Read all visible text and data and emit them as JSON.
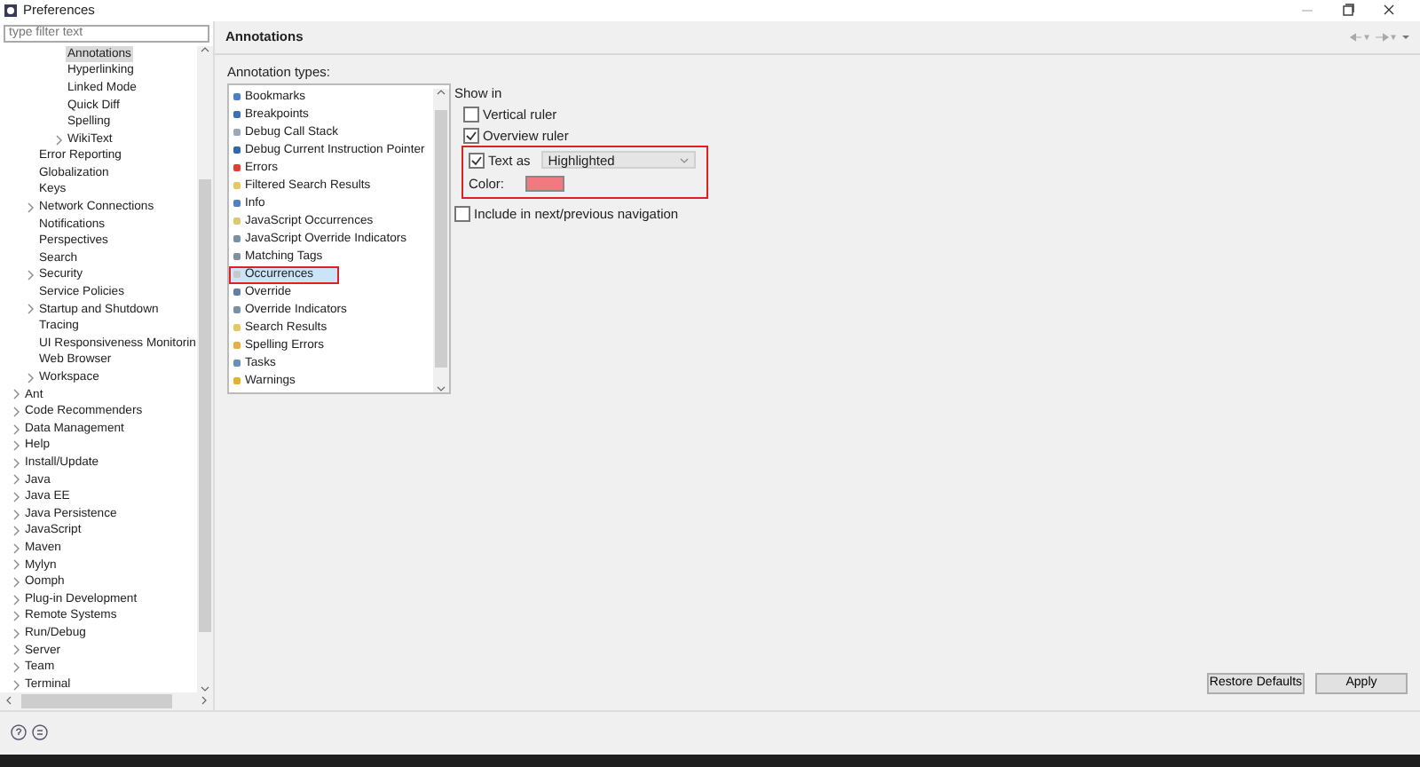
{
  "window": {
    "title": "Preferences"
  },
  "filter": {
    "placeholder": "type filter text"
  },
  "tree": [
    {
      "children": [
        {
          "children": [
            {
              "label": "Annotations",
              "selected": true,
              "expandable": false
            },
            {
              "label": "Hyperlinking",
              "selected": false,
              "expandable": false
            },
            {
              "label": "Linked Mode",
              "selected": false,
              "expandable": false
            },
            {
              "label": "Quick Diff",
              "selected": false,
              "expandable": false
            },
            {
              "label": "Spelling",
              "selected": false,
              "expandable": false
            },
            {
              "label": "WikiText",
              "selected": false,
              "expandable": true
            }
          ]
        },
        {
          "label": "Error Reporting",
          "selected": false,
          "expandable": false
        },
        {
          "label": "Globalization",
          "selected": false,
          "expandable": false
        },
        {
          "label": "Keys",
          "selected": false,
          "expandable": false
        },
        {
          "label": "Network Connections",
          "selected": false,
          "expandable": true
        },
        {
          "label": "Notifications",
          "selected": false,
          "expandable": false
        },
        {
          "label": "Perspectives",
          "selected": false,
          "expandable": false
        },
        {
          "label": "Search",
          "selected": false,
          "expandable": false
        },
        {
          "label": "Security",
          "selected": false,
          "expandable": true
        },
        {
          "label": "Service Policies",
          "selected": false,
          "expandable": false
        },
        {
          "label": "Startup and Shutdown",
          "selected": false,
          "expandable": true
        },
        {
          "label": "Tracing",
          "selected": false,
          "expandable": false
        },
        {
          "label": "UI Responsiveness Monitorin",
          "selected": false,
          "expandable": false
        },
        {
          "label": "Web Browser",
          "selected": false,
          "expandable": false
        },
        {
          "label": "Workspace",
          "selected": false,
          "expandable": true
        }
      ]
    },
    {
      "label": "Ant",
      "selected": false,
      "expandable": true
    },
    {
      "label": "Code Recommenders",
      "selected": false,
      "expandable": true
    },
    {
      "label": "Data Management",
      "selected": false,
      "expandable": true
    },
    {
      "label": "Help",
      "selected": false,
      "expandable": true
    },
    {
      "label": "Install/Update",
      "selected": false,
      "expandable": true
    },
    {
      "label": "Java",
      "selected": false,
      "expandable": true
    },
    {
      "label": "Java EE",
      "selected": false,
      "expandable": true
    },
    {
      "label": "Java Persistence",
      "selected": false,
      "expandable": true
    },
    {
      "label": "JavaScript",
      "selected": false,
      "expandable": true
    },
    {
      "label": "Maven",
      "selected": false,
      "expandable": true
    },
    {
      "label": "Mylyn",
      "selected": false,
      "expandable": true
    },
    {
      "label": "Oomph",
      "selected": false,
      "expandable": true
    },
    {
      "label": "Plug-in Development",
      "selected": false,
      "expandable": true
    },
    {
      "label": "Remote Systems",
      "selected": false,
      "expandable": true
    },
    {
      "label": "Run/Debug",
      "selected": false,
      "expandable": true
    },
    {
      "label": "Server",
      "selected": false,
      "expandable": true
    },
    {
      "label": "Team",
      "selected": false,
      "expandable": true
    },
    {
      "label": "Terminal",
      "selected": false,
      "expandable": true
    }
  ],
  "page": {
    "title": "Annotations",
    "list_label": "Annotation types:",
    "annotation_types": [
      {
        "label": "Bookmarks",
        "color": "#4a7fd0",
        "selected": false,
        "outlined": false
      },
      {
        "label": "Breakpoints",
        "color": "#3a6fc0",
        "selected": false,
        "outlined": false
      },
      {
        "label": "Debug Call Stack",
        "color": "#9aa8b8",
        "selected": false,
        "outlined": false
      },
      {
        "label": "Debug Current Instruction Pointer",
        "color": "#3068b0",
        "selected": false,
        "outlined": false
      },
      {
        "label": "Errors",
        "color": "#e04030",
        "selected": false,
        "outlined": false
      },
      {
        "label": "Filtered Search Results",
        "color": "#e8c860",
        "selected": false,
        "outlined": false
      },
      {
        "label": "Info",
        "color": "#5080c8",
        "selected": false,
        "outlined": false
      },
      {
        "label": "JavaScript Occurrences",
        "color": "#e0c870",
        "selected": false,
        "outlined": false
      },
      {
        "label": "JavaScript Override Indicators",
        "color": "#7890a8",
        "selected": false,
        "outlined": false
      },
      {
        "label": "Matching Tags",
        "color": "#8090a0",
        "selected": false,
        "outlined": false
      },
      {
        "label": "Occurrences",
        "color": "#c8c8c8",
        "selected": true,
        "outlined": true
      },
      {
        "label": "Override",
        "color": "#6080a8",
        "selected": false,
        "outlined": false
      },
      {
        "label": "Override Indicators",
        "color": "#7890a8",
        "selected": false,
        "outlined": false
      },
      {
        "label": "Search Results",
        "color": "#e8c860",
        "selected": false,
        "outlined": false
      },
      {
        "label": "Spelling Errors",
        "color": "#e8b040",
        "selected": false,
        "outlined": false
      },
      {
        "label": "Tasks",
        "color": "#6890b8",
        "selected": false,
        "outlined": false
      },
      {
        "label": "Warnings",
        "color": "#e8b030",
        "selected": false,
        "outlined": false
      }
    ],
    "show_in": "Show in",
    "vertical_ruler": {
      "label": "Vertical ruler",
      "checked": false
    },
    "overview_ruler": {
      "label": "Overview ruler",
      "checked": true
    },
    "text_as": {
      "label": "Text as",
      "checked": true,
      "value": "Highlighted",
      "outlined": true
    },
    "color": {
      "label": "Color:",
      "color": "#f07a80"
    },
    "navigation": {
      "label": "Include in next/previous navigation",
      "checked": false
    },
    "buttons": [
      "Restore Defaults",
      "Apply"
    ]
  }
}
